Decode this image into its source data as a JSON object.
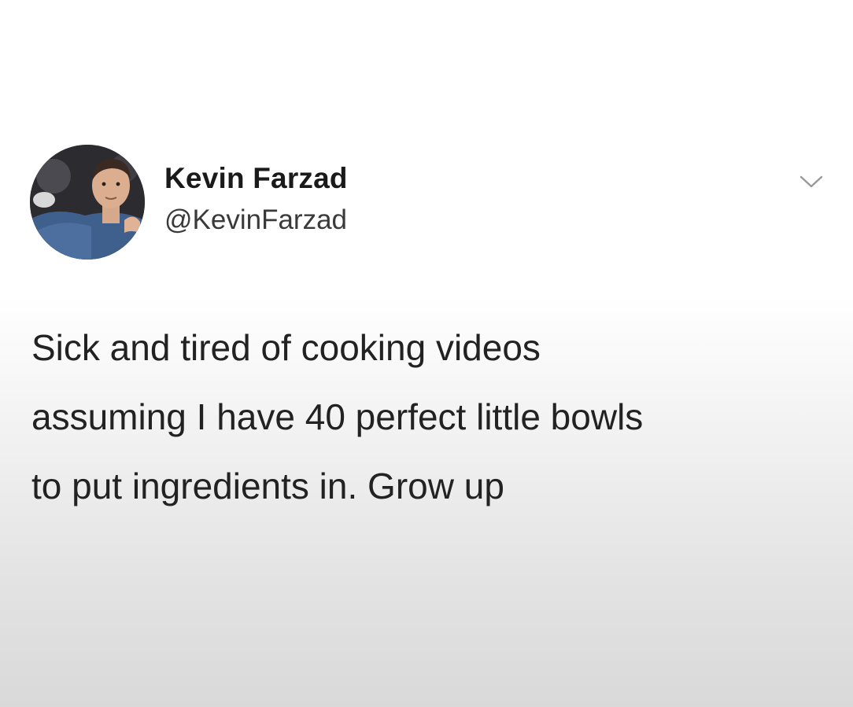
{
  "tweet": {
    "author": {
      "display_name": "Kevin Farzad",
      "handle": "@KevinFarzad",
      "avatar_icon": "profile-photo"
    },
    "menu_icon": "chevron-down-icon",
    "text_lines": [
      "Sick and tired of cooking videos",
      "assuming I have 40 perfect little bowls",
      "to put ingredients in. Grow up"
    ]
  },
  "colors": {
    "name_text": "#1a1a1a",
    "handle_text": "#3a3a3a",
    "body_text": "#222222",
    "chevron": "#9a9a9a"
  }
}
